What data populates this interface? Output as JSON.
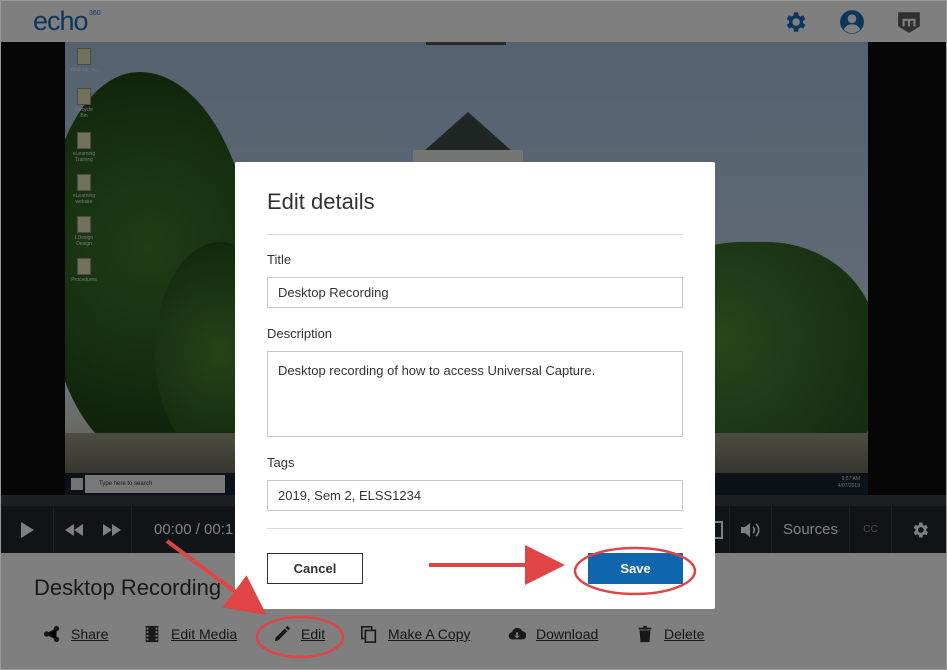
{
  "header": {
    "logo": "echo",
    "logo_sup": "360",
    "icons": [
      "gear-icon",
      "user-account-icon",
      "moodle-icon"
    ]
  },
  "player": {
    "time": "00:00 / 00:1",
    "sources_label": "Sources",
    "cc_label": "CC",
    "desktop": {
      "icons": [
        "desktop_re...",
        "Recycle Bin",
        "eLearning Training",
        "eLearning website",
        "LDesign Design",
        "Procedures"
      ],
      "taskbar_search": "Type here to search",
      "clock": [
        "9:57 AM",
        "4/07/2019"
      ]
    }
  },
  "recording_title": "Desktop Recording",
  "actions": [
    {
      "label": "Share",
      "icon": "share-icon"
    },
    {
      "label": "Edit Media",
      "icon": "film-icon"
    },
    {
      "label": "Edit",
      "icon": "pencil-icon"
    },
    {
      "label": "Make A Copy",
      "icon": "copy-icon"
    },
    {
      "label": "Download",
      "icon": "cloud-download-icon"
    },
    {
      "label": "Delete",
      "icon": "trash-icon"
    }
  ],
  "modal": {
    "heading": "Edit details",
    "title_label": "Title",
    "title_value": "Desktop Recording",
    "description_label": "Description",
    "description_value": "Desktop recording of how to access Universal Capture.",
    "tags_label": "Tags",
    "tags_value": "2019, Sem 2, ELSS1234",
    "cancel_label": "Cancel",
    "save_label": "Save"
  },
  "colors": {
    "brand": "#1a6fb4",
    "save_button": "#1066ad",
    "annotation": "#e04444"
  }
}
